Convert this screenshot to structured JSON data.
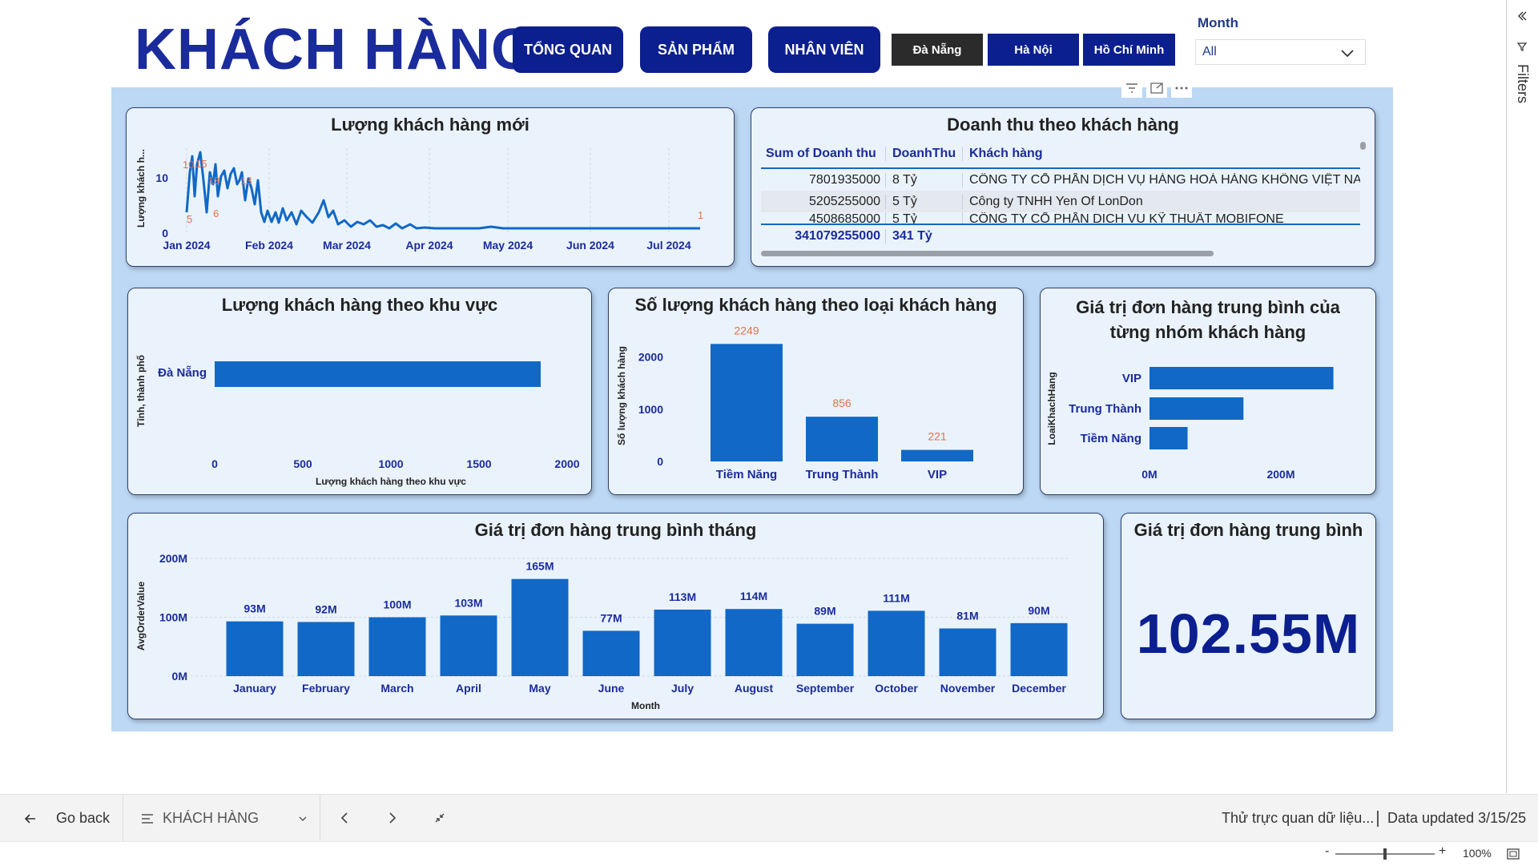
{
  "page_title": "KHÁCH HÀNG",
  "nav_buttons": [
    "TỔNG QUAN",
    "SẢN PHẨM",
    "NHÂN VIÊN"
  ],
  "city_buttons": [
    {
      "label": "Đà Nẵng",
      "color": "#2b2b2b"
    },
    {
      "label": "Hà Nội",
      "color": "#0b1f8f"
    },
    {
      "label": "Hồ Chí Minh",
      "color": "#0b1f8f"
    }
  ],
  "month_filter": {
    "label": "Month",
    "value": "All"
  },
  "filters_pane_label": "Filters",
  "colors": {
    "accent": "#0b1f8f",
    "bar": "#1168c6",
    "canvas": "#bcd8f5",
    "card": "#eaf3fc",
    "datalabel": "#e0724a"
  },
  "new_customers": {
    "title": "Lượng khách hàng mới",
    "ylabel": "Lượng khách h...",
    "yticks": [
      "0",
      "10"
    ],
    "xticks": [
      "Jan 2024",
      "Feb 2024",
      "Mar 2024",
      "Apr 2024",
      "May 2024",
      "Jun 2024",
      "Jul 2024"
    ],
    "labels": [
      "10",
      "15",
      "13",
      "13",
      "5",
      "6",
      "1"
    ]
  },
  "revenue_table": {
    "title": "Doanh thu theo khách hàng",
    "columns": [
      "Sum of Doanh thu",
      "DoanhThu",
      "Khách hàng"
    ],
    "rows": [
      [
        "7801935000",
        "8 Tỷ",
        "CÔNG TY CỔ PHẦN DỊCH VỤ HÀNG HOÁ HÀNG KHÔNG VIỆT NAM"
      ],
      [
        "5205255000",
        "5 Tỷ",
        "Công ty TNHH Yen Of LonDon"
      ],
      [
        "4508685000",
        "5 Tỷ",
        "CÔNG TY CỔ PHẦN DỊCH VỤ KỸ THUẬT MOBIFONE"
      ]
    ],
    "total": [
      "341079255000",
      "341 Tỷ",
      ""
    ]
  },
  "charts": {
    "region": {
      "title": "Lượng khách hàng theo khu vực",
      "chart_data": {
        "type": "bar",
        "orientation": "horizontal",
        "categories": [
          "Đà Nẵng"
        ],
        "values": [
          1850
        ],
        "xlabel": "Lượng khách hàng theo khu vực",
        "ylabel": "Tỉnh, thành phố",
        "xlim": [
          0,
          2000
        ],
        "xticks": [
          "0",
          "500",
          "1000",
          "1500",
          "2000"
        ]
      }
    },
    "type": {
      "title": "Số lượng khách hàng theo loại khách hàng",
      "chart_data": {
        "type": "bar",
        "categories": [
          "Tiềm Năng",
          "Trung Thành",
          "VIP"
        ],
        "values": [
          2249,
          856,
          221
        ],
        "ylabel": "Số lượng khách hàng",
        "ylim": [
          0,
          2300
        ],
        "yticks": [
          "0",
          "1000",
          "2000"
        ]
      }
    },
    "group_avg": {
      "title": "Giá trị đơn hàng trung bình của từng nhóm khách hàng",
      "chart_data": {
        "type": "bar",
        "orientation": "horizontal",
        "categories": [
          "VIP",
          "Trung Thành",
          "Tiềm Năng"
        ],
        "values": [
          280,
          143,
          58
        ],
        "ylabel": "LoaiKhachHang",
        "xlim": [
          0,
          300
        ],
        "xticks": [
          "0M",
          "200M"
        ]
      }
    },
    "monthly": {
      "title": "Giá trị đơn hàng trung bình tháng",
      "chart_data": {
        "type": "bar",
        "categories": [
          "January",
          "February",
          "March",
          "April",
          "May",
          "June",
          "July",
          "August",
          "September",
          "October",
          "November",
          "December"
        ],
        "values": [
          93,
          92,
          100,
          103,
          165,
          77,
          113,
          114,
          89,
          111,
          81,
          90
        ],
        "labels": [
          "93M",
          "92M",
          "100M",
          "103M",
          "165M",
          "77M",
          "113M",
          "114M",
          "89M",
          "111M",
          "81M",
          "90M"
        ],
        "xlabel": "Month",
        "ylabel": "AvgOrderValue",
        "ylim": [
          0,
          200
        ],
        "yticks": [
          "0M",
          "100M",
          "200M"
        ]
      }
    }
  },
  "avg_card": {
    "title": "Giá trị đơn hàng trung bình",
    "value": "102.55M"
  },
  "bottom_bar": {
    "go_back": "Go back",
    "page_menu": "KHÁCH HÀNG",
    "ask_data": "Thử trực quan dữ liệu...",
    "updated": "Data updated 3/15/25",
    "zoom": "100%"
  }
}
